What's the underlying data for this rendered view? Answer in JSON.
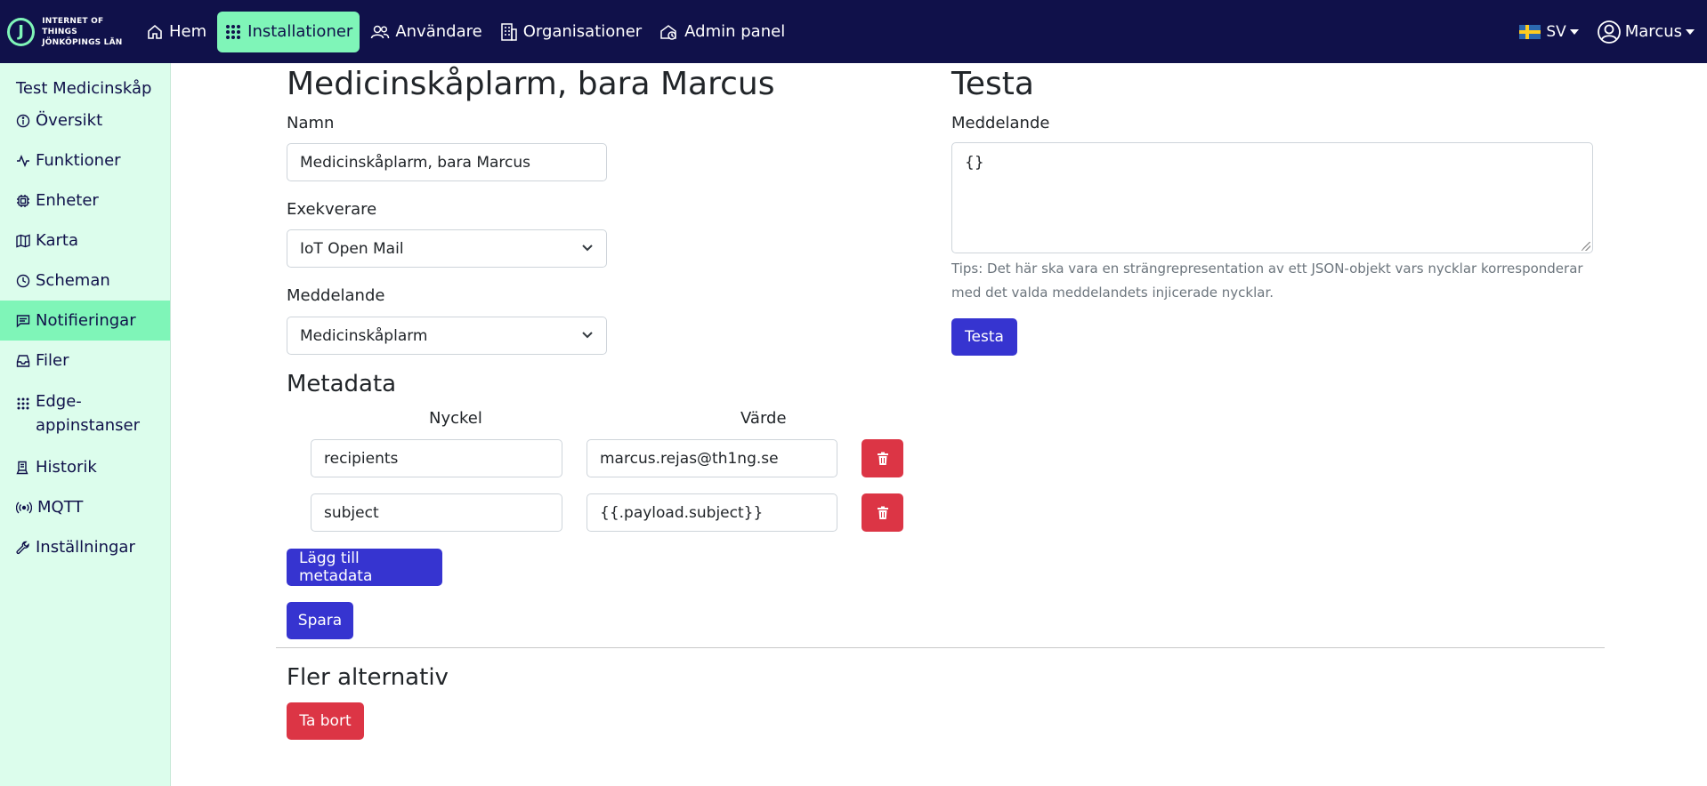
{
  "brand": {
    "line1": "INTERNET OF THINGS",
    "line2": "JÖNKÖPINGS LÄN"
  },
  "nav": {
    "items": [
      {
        "label": "Hem",
        "icon": "home-icon"
      },
      {
        "label": "Installationer",
        "icon": "grid-icon",
        "active": true
      },
      {
        "label": "Användare",
        "icon": "users-icon"
      },
      {
        "label": "Organisationer",
        "icon": "building-icon"
      },
      {
        "label": "Admin panel",
        "icon": "admin-icon"
      }
    ],
    "language": "SV",
    "user": "Marcus"
  },
  "sidebar": {
    "title": "Test Medicinskåp",
    "items": [
      {
        "label": "Översikt",
        "icon": "info-icon"
      },
      {
        "label": "Funktioner",
        "icon": "activity-icon"
      },
      {
        "label": "Enheter",
        "icon": "cpu-icon"
      },
      {
        "label": "Karta",
        "icon": "map-icon"
      },
      {
        "label": "Scheman",
        "icon": "clock-icon"
      },
      {
        "label": "Notifieringar",
        "icon": "chat-icon",
        "active": true
      },
      {
        "label": "Filer",
        "icon": "inbox-icon"
      },
      {
        "label": "Edge-",
        "label2": "appinstanser",
        "icon": "apps-icon"
      },
      {
        "label": "Historik",
        "icon": "history-icon"
      },
      {
        "label": "MQTT",
        "icon": "broadcast-icon"
      },
      {
        "label": "Inställningar",
        "icon": "wrench-icon"
      }
    ]
  },
  "form": {
    "title": "Medicinskåplarm, bara Marcus",
    "name_label": "Namn",
    "name_value": "Medicinskåplarm, bara Marcus",
    "executor_label": "Exekverare",
    "executor_value": "IoT Open Mail",
    "message_label": "Meddelande",
    "message_value": "Medicinskåplarm",
    "metadata_title": "Metadata",
    "key_header": "Nyckel",
    "value_header": "Värde",
    "metadata": [
      {
        "key": "recipients",
        "value": "marcus.rejas@th1ng.se"
      },
      {
        "key": "subject",
        "value": "{{.payload.subject}}"
      }
    ],
    "add_metadata_label": "Lägg till metadata",
    "save_label": "Spara",
    "more_options_title": "Fler alternativ",
    "delete_label": "Ta bort"
  },
  "test": {
    "title": "Testa",
    "message_label": "Meddelande",
    "message_value": "{}",
    "tips": "Tips: Det här ska vara en strängrepresentation av ett JSON-objekt vars nycklar korresponderar med det valda meddelandets injicerade nycklar.",
    "test_label": "Testa"
  },
  "colors": {
    "navbar": "#10114a",
    "accent": "#7ff5b8",
    "sidebar": "#dcfdec",
    "primary": "#3634d0",
    "danger": "#dc3545"
  }
}
